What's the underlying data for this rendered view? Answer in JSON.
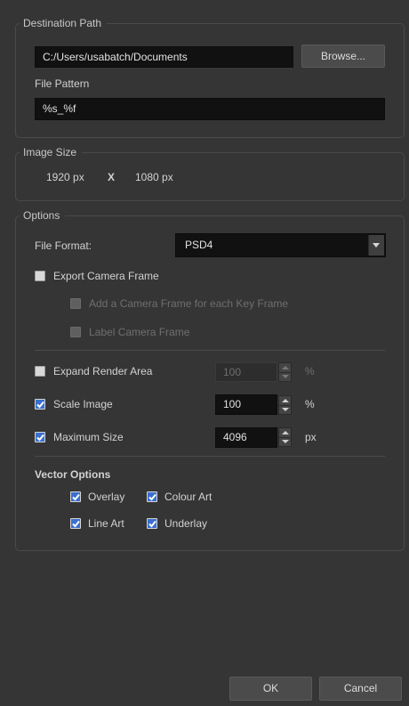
{
  "destination": {
    "title": "Destination Path",
    "path_value": "C:/Users/usabatch/Documents",
    "browse_label": "Browse...",
    "file_pattern_label": "File Pattern",
    "file_pattern_value": "%s_%f"
  },
  "image_size": {
    "title": "Image Size",
    "width": "1920 px",
    "times": "X",
    "height": "1080 px"
  },
  "options": {
    "title": "Options",
    "file_format_label": "File Format:",
    "file_format_value": "PSD4",
    "export_camera_frame": {
      "label": "Export Camera Frame",
      "checked": false
    },
    "add_camera_frame": {
      "label": "Add a Camera Frame for each Key Frame",
      "checked": false,
      "enabled": false
    },
    "label_camera_frame": {
      "label": "Label Camera Frame",
      "checked": false,
      "enabled": false
    },
    "expand_render_area": {
      "label": "Expand Render Area",
      "checked": false,
      "value": "100",
      "unit": "%"
    },
    "scale_image": {
      "label": "Scale Image",
      "checked": true,
      "value": "100",
      "unit": "%"
    },
    "maximum_size": {
      "label": "Maximum Size",
      "checked": true,
      "value": "4096",
      "unit": "px"
    },
    "vector_options_title": "Vector Options",
    "overlay": {
      "label": "Overlay",
      "checked": true
    },
    "colour_art": {
      "label": "Colour Art",
      "checked": true
    },
    "line_art": {
      "label": "Line Art",
      "checked": true
    },
    "underlay": {
      "label": "Underlay",
      "checked": true
    }
  },
  "footer": {
    "ok_label": "OK",
    "cancel_label": "Cancel"
  },
  "icons": {
    "dropdown": "chevron-down-icon",
    "spin_up": "arrow-up-icon",
    "spin_down": "arrow-down-icon",
    "check": "check-icon"
  }
}
